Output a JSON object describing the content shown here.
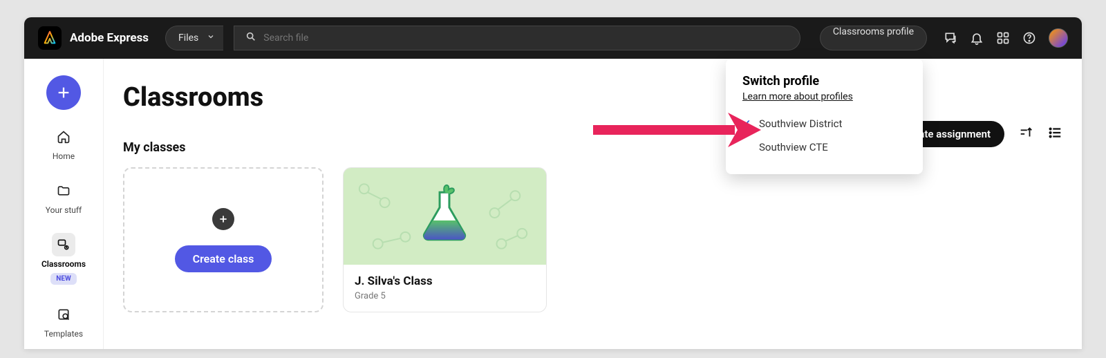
{
  "brand": {
    "name": "Adobe Express"
  },
  "topbar": {
    "files_dropdown": "Files",
    "search_placeholder": "Search file",
    "profile_button": "Classrooms profile"
  },
  "sidebar": {
    "items": [
      {
        "label": "Home"
      },
      {
        "label": "Your stuff"
      },
      {
        "label": "Classrooms",
        "badge": "NEW"
      },
      {
        "label": "Templates"
      }
    ]
  },
  "main": {
    "title": "Classrooms",
    "create_assignment": "Create assignment",
    "section_heading": "My classes",
    "create_class_btn": "Create class",
    "classes": [
      {
        "name": "J. Silva's Class",
        "subtitle": "Grade 5"
      }
    ]
  },
  "popover": {
    "title": "Switch profile",
    "learn_more": "Learn more about profiles",
    "profiles": [
      {
        "name": "Southview District",
        "selected": true
      },
      {
        "name": "Southview CTE",
        "selected": false
      }
    ]
  }
}
